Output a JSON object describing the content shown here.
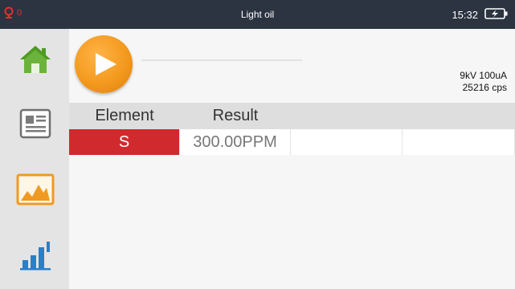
{
  "status_bar": {
    "alert_count": "0",
    "title": "Light oil",
    "time": "15:32"
  },
  "sidebar": {
    "items": [
      {
        "name": "home",
        "icon": "home-icon"
      },
      {
        "name": "report",
        "icon": "document-icon"
      },
      {
        "name": "spectrum",
        "icon": "spectrum-chart-icon"
      },
      {
        "name": "statistics",
        "icon": "bar-chart-icon"
      }
    ]
  },
  "measurement": {
    "voltage_current": "9kV 100uA",
    "count_rate": "25216 cps"
  },
  "table": {
    "headers": [
      "Element",
      "Result"
    ],
    "rows": [
      {
        "element": "S",
        "result": "300.00PPM"
      }
    ]
  },
  "colors": {
    "top_bar": "#2b3440",
    "element_highlight": "#d12a2e",
    "play_button": "#f39a1e"
  }
}
